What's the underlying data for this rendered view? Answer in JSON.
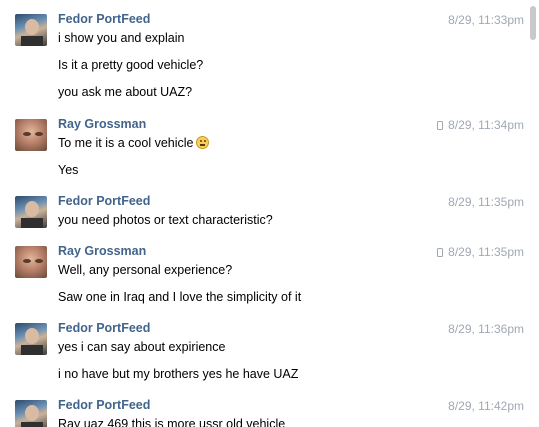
{
  "messages": [
    {
      "author": "Fedor PortFeed",
      "time": "8/29, 11:33pm",
      "mobile": false,
      "lines": [
        "i show you and explain",
        "Is it a pretty good vehicle?",
        "you ask me about UAZ?"
      ]
    },
    {
      "author": "Ray Grossman",
      "time": "8/29, 11:34pm",
      "mobile": true,
      "lines": [
        "To me it is a cool vehicle",
        "Yes"
      ]
    },
    {
      "author": "Fedor PortFeed",
      "time": "8/29, 11:35pm",
      "mobile": false,
      "lines": [
        "you need photos or text characteristic?"
      ]
    },
    {
      "author": "Ray Grossman",
      "time": "8/29, 11:35pm",
      "mobile": true,
      "lines": [
        "Well, any personal experience?",
        "Saw one in Iraq and I love the simplicity of it"
      ]
    },
    {
      "author": "Fedor PortFeed",
      "time": "8/29, 11:36pm",
      "mobile": false,
      "lines": [
        "yes i can say about expirience",
        "i no have but my brothers yes he have UAZ"
      ]
    },
    {
      "author": "Fedor PortFeed",
      "time": "8/29, 11:42pm",
      "mobile": false,
      "lines": [
        "Ray uaz 469 this is more ussr old vehicle"
      ]
    }
  ],
  "icons": {
    "avatar_fedor": "avatar-photo",
    "avatar_ray": "avatar-photo",
    "mobile": "phone-icon",
    "emoji": "emoji-icon"
  },
  "colors": {
    "author": "#42648b",
    "time": "#a0a8b3",
    "text": "#000000"
  }
}
